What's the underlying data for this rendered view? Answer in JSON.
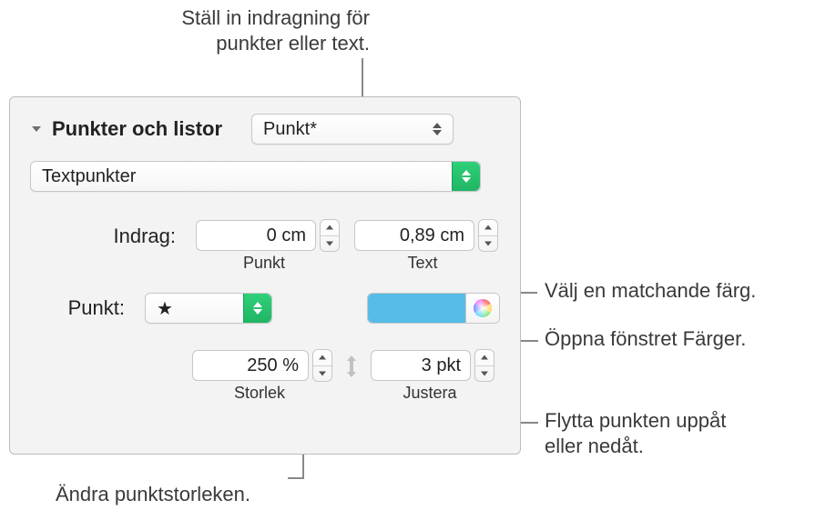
{
  "callouts": {
    "indent_set": "Ställ in indragning för\npunkter eller text.",
    "match_color": "Välj en matchande färg.",
    "open_colors": "Öppna fönstret Färger.",
    "move_bullet": "Flytta punkten uppåt\neller nedåt.",
    "change_size": "Ändra punktstorleken."
  },
  "section": {
    "title": "Punkter och listor"
  },
  "liststyle": {
    "value": "Punkt*"
  },
  "bullettype": {
    "value": "Textpunkter"
  },
  "indent": {
    "label": "Indrag:",
    "bullet_value": "0 cm",
    "bullet_sublabel": "Punkt",
    "text_value": "0,89 cm",
    "text_sublabel": "Text"
  },
  "bullet": {
    "label": "Punkt:",
    "symbol": "★"
  },
  "size": {
    "value": "250 %",
    "sublabel": "Storlek"
  },
  "align": {
    "value": "3 pkt",
    "sublabel": "Justera"
  }
}
